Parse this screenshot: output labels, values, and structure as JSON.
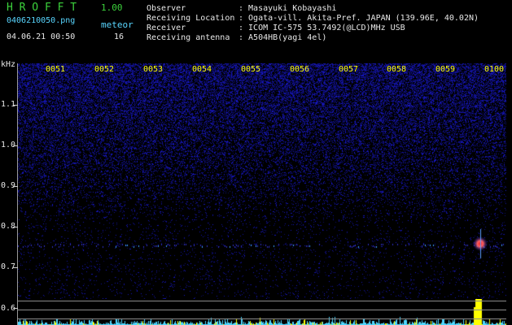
{
  "header": {
    "app_name": "H R O F F T",
    "version": "1.00",
    "filename": "0406210050.png",
    "meteor_label": "meteor",
    "datetime": "04.06.21 00:50",
    "meteor_count": "16",
    "info_lines": [
      {
        "key": "Observer",
        "value": ": Masayuki Kobayashi"
      },
      {
        "key": "Receiving Location",
        "value": ": Ogata-vill. Akita-Pref. JAPAN (139.96E, 40.02N)"
      },
      {
        "key": "Receiver",
        "value": ": ICOM IC-575 53.7492(@LCD)MHz USB"
      },
      {
        "key": "Receiving antenna",
        "value": ": A504HB(yagi 4el)"
      }
    ]
  },
  "spectrogram": {
    "y_unit": "kHz",
    "y_labels": [
      "1.1",
      "1.0",
      "0.9",
      "0.8",
      "0.7",
      "0.6"
    ],
    "time_labels": [
      "0051",
      "0052",
      "0053",
      "0054",
      "0055",
      "0056",
      "0057",
      "0058",
      "0059",
      "0100"
    ],
    "colors": {
      "background": "#000000",
      "noise": "#1c1cb4",
      "header_green": "#3cd23c",
      "header_cyan": "#59d6ff",
      "time_yellow": "#ffff00",
      "echo_red": "#ff3030",
      "level_yellow": "#ffff00",
      "level_cyan": "#4fd7ff"
    }
  }
}
